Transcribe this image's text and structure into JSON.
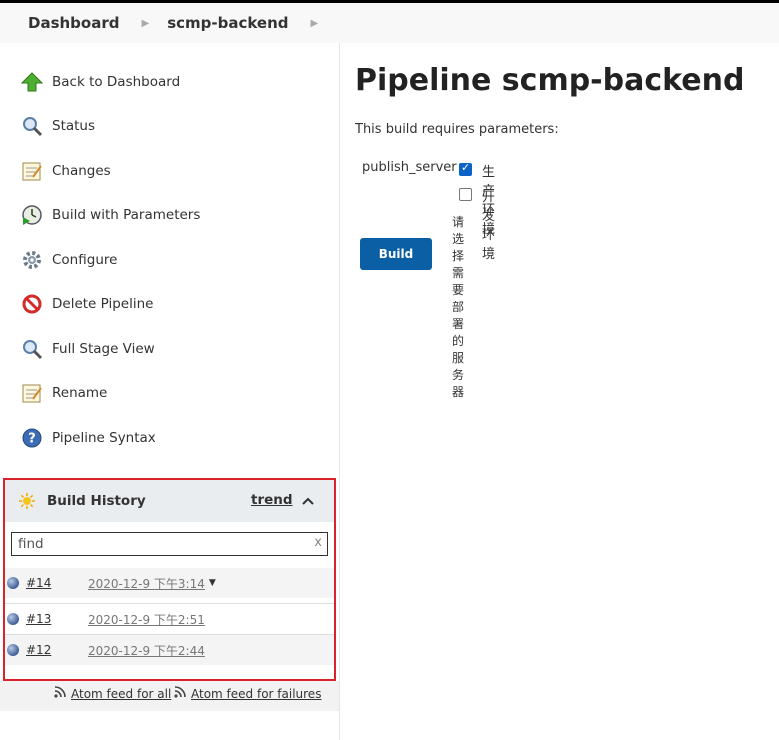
{
  "breadcrumbs": [
    {
      "label": "Dashboard"
    },
    {
      "label": "scmp-backend"
    }
  ],
  "sidebar": {
    "tasks": [
      {
        "label": "Back to Dashboard",
        "icon": "green-up-arrow-icon"
      },
      {
        "label": "Status",
        "icon": "magnifier-icon"
      },
      {
        "label": "Changes",
        "icon": "notepad-icon"
      },
      {
        "label": "Build with Parameters",
        "icon": "build-clock-icon"
      },
      {
        "label": "Configure",
        "icon": "gear-icon"
      },
      {
        "label": "Delete Pipeline",
        "icon": "no-entry-icon"
      },
      {
        "label": "Full Stage View",
        "icon": "magnifier-icon"
      },
      {
        "label": "Rename",
        "icon": "notepad-icon"
      },
      {
        "label": "Pipeline Syntax",
        "icon": "help-icon"
      }
    ]
  },
  "build_history": {
    "title": "Build History",
    "trend_label": "trend",
    "search_placeholder": "find",
    "clear_label": "x",
    "builds": [
      {
        "number": "#14",
        "date": "2020-12-9 下午3:14",
        "status": "blue"
      },
      {
        "number": "#13",
        "date": "2020-12-9 下午2:51",
        "status": "blue"
      },
      {
        "number": "#12",
        "date": "2020-12-9 下午2:44",
        "status": "blue"
      }
    ],
    "feeds": {
      "all": "Atom feed for all",
      "failures": "Atom feed for failures"
    }
  },
  "main": {
    "title": "Pipeline scmp-backend",
    "requires_text": "This build requires parameters:",
    "parameter": {
      "name": "publish_server",
      "options": [
        {
          "label": "生产环境",
          "checked": true
        },
        {
          "label": "开发环境",
          "checked": false
        }
      ],
      "description": "请选择需要部署的服务器"
    },
    "build_button": "Build"
  },
  "colors": {
    "accent": "#0b5fa5",
    "highlight_border": "#d8232a",
    "header_bg": "#f8f8f8"
  }
}
